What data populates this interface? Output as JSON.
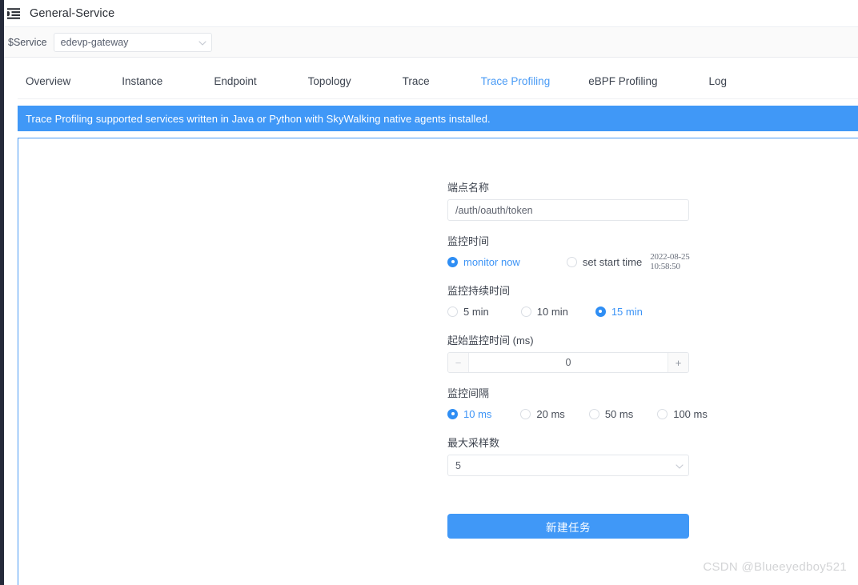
{
  "titlebar": {
    "fold_icon": "menu-fold-icon",
    "title": "General-Service"
  },
  "service_bar": {
    "label": "$Service",
    "selected": "edevp-gateway",
    "chevron_icon": "chevron-down-icon"
  },
  "tabs": [
    {
      "label": "Overview",
      "active": false
    },
    {
      "label": "Instance",
      "active": false
    },
    {
      "label": "Endpoint",
      "active": false
    },
    {
      "label": "Topology",
      "active": false
    },
    {
      "label": "Trace",
      "active": false
    },
    {
      "label": "Trace Profiling",
      "active": true
    },
    {
      "label": "eBPF Profiling",
      "active": false
    },
    {
      "label": "Log",
      "active": false
    }
  ],
  "notice": {
    "text": "Trace Profiling supported services written in Java or Python with SkyWalking native agents installed."
  },
  "form": {
    "endpoint": {
      "label": "端点名称",
      "value": "/auth/oauth/token",
      "placeholder": "/auth/oauth/token"
    },
    "monitor_time": {
      "label": "监控时间",
      "options": [
        {
          "label": "monitor now",
          "checked": true
        },
        {
          "label": "set start time",
          "checked": false
        }
      ],
      "start_time": "2022-08-25 10:58:50"
    },
    "duration": {
      "label": "监控持续时间",
      "options": [
        {
          "label": "5 min",
          "checked": false
        },
        {
          "label": "10 min",
          "checked": false
        },
        {
          "label": "15 min",
          "checked": true
        }
      ]
    },
    "min_duration": {
      "label": "起始监控时间 (ms)",
      "value": "0",
      "minus": "−",
      "plus": "+"
    },
    "interval": {
      "label": "监控间隔",
      "options": [
        {
          "label": "10 ms",
          "checked": true
        },
        {
          "label": "20 ms",
          "checked": false
        },
        {
          "label": "50 ms",
          "checked": false
        },
        {
          "label": "100 ms",
          "checked": false
        }
      ]
    },
    "max_sampling": {
      "label": "最大采样数",
      "value": "5",
      "chevron_icon": "chevron-down-icon"
    },
    "submit_label": "新建任务"
  },
  "watermark": {
    "text": "CSDN @Blueeyedboy521"
  },
  "colors": {
    "accent": "#4098f7",
    "accent_text": "#4a9bf5",
    "rail": "#252a3a",
    "banner": "#4098f7"
  }
}
